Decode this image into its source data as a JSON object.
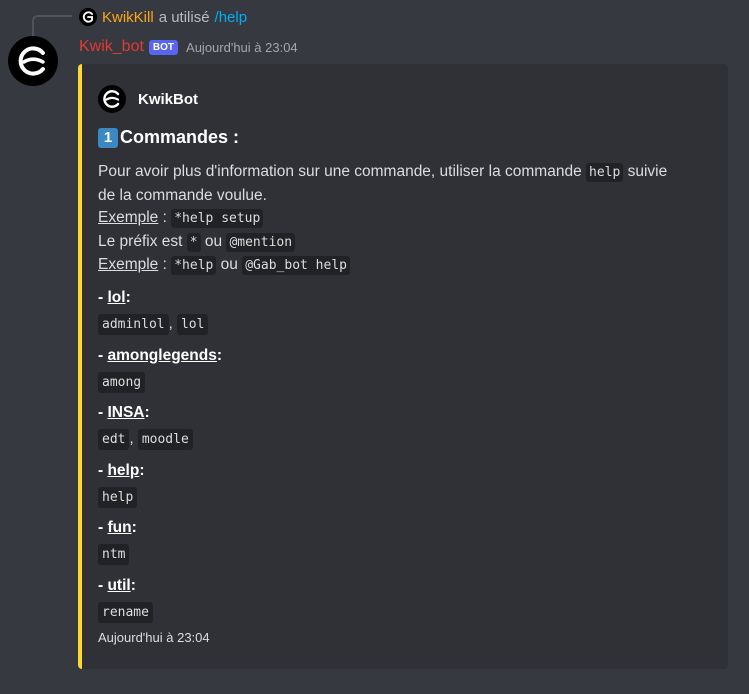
{
  "reply": {
    "username": "KwikKill",
    "action": "a utilisé",
    "command": "/help"
  },
  "message": {
    "username": "Kwik_bot",
    "bot_tag": "BOT",
    "timestamp": "Aujourd'hui à 23:04"
  },
  "embed": {
    "author": "KwikBot",
    "title_emoji": "1",
    "title": "Commandes :",
    "description": {
      "line1_a": "Pour avoir plus d'information sur une commande, utiliser la commande ",
      "line1_code": "help",
      "line1_b": " suivie",
      "line2": "de la commande voulue.",
      "ex1_label": "Exemple",
      "ex1_sep": " : ",
      "ex1_code": "*help setup",
      "prefix_a": "Le préfix est ",
      "prefix_code1": "*",
      "prefix_b": " ou ",
      "prefix_code2": "@mention",
      "ex2_label": "Exemple",
      "ex2_sep": " : ",
      "ex2_code1": "*help",
      "ex2_mid": " ou ",
      "ex2_code2": "@Gab_bot help"
    },
    "fields": [
      {
        "prefix": "- ",
        "name": "lol",
        "suffix": ":",
        "values": [
          "adminlol",
          "lol"
        ]
      },
      {
        "prefix": "- ",
        "name": "amonglegends",
        "suffix": ":",
        "values": [
          "among"
        ]
      },
      {
        "prefix": "- ",
        "name": "INSA",
        "suffix": ":",
        "values": [
          "edt",
          "moodle"
        ]
      },
      {
        "prefix": "- ",
        "name": "help",
        "suffix": ":",
        "values": [
          "help"
        ]
      },
      {
        "prefix": "- ",
        "name": "fun",
        "suffix": ":",
        "values": [
          "ntm"
        ]
      },
      {
        "prefix": "- ",
        "name": "util",
        "suffix": ":",
        "values": [
          "rename"
        ]
      }
    ],
    "value_separator": ", ",
    "footer": "Aujourd'hui à 23:04"
  },
  "colors": {
    "embed_accent": "#fdd835",
    "username": "#e53935",
    "reply_username": "#faa61a",
    "command_link": "#00aff4",
    "bot_tag": "#5865f2"
  },
  "icons": {
    "avatar": "g-logo-icon",
    "author": "g-logo-icon",
    "title_emoji": "keycap-one-icon"
  }
}
